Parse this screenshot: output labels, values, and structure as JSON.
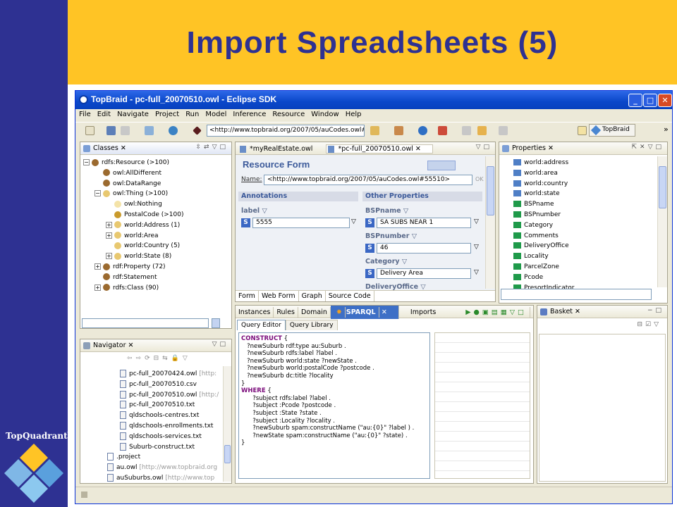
{
  "slide": {
    "title": "Import Spreadsheets (5)",
    "logo": "TopQuadrant",
    "logo_tm": "TM"
  },
  "window": {
    "title": "TopBraid - pc-full_20070510.owl - Eclipse SDK",
    "controls": [
      "_",
      "□",
      "✕"
    ]
  },
  "menu": [
    "File",
    "Edit",
    "Navigate",
    "Project",
    "Run",
    "Model",
    "Inference",
    "Resource",
    "Window",
    "Help"
  ],
  "toolbar": {
    "url": "<http://www.topbraid.org/2007/05/auCodes.owl#5",
    "perspective": "TopBraid",
    "more": "»"
  },
  "classes": {
    "tab": "Classes",
    "items": [
      {
        "label": "rdfs:Resource  (>100)",
        "toggle": "−",
        "color": "#9b6a2f"
      },
      {
        "label": "owl:AllDifferent",
        "toggle": "",
        "color": "#9b6a2f"
      },
      {
        "label": "owl:DataRange",
        "toggle": "",
        "color": "#9b6a2f"
      },
      {
        "label": "owl:Thing  (>100)",
        "toggle": "−",
        "color": "#e8c870"
      },
      {
        "label": "owl:Nothing",
        "toggle": "",
        "color": "#f4e3a8"
      },
      {
        "label": "PostalCode  (>100)",
        "toggle": "",
        "color": "#c99a2c"
      },
      {
        "label": "world:Address  (1)",
        "toggle": "+",
        "color": "#e8c870"
      },
      {
        "label": "world:Area",
        "toggle": "+",
        "color": "#e8c870"
      },
      {
        "label": "world:Country  (5)",
        "toggle": "",
        "color": "#e8c870"
      },
      {
        "label": "world:State  (8)",
        "toggle": "+",
        "color": "#e8c870"
      },
      {
        "label": "rdf:Property  (72)",
        "toggle": "+",
        "color": "#9b6a2f"
      },
      {
        "label": "rdf:Statement",
        "toggle": "",
        "color": "#9b6a2f"
      },
      {
        "label": "rdfs:Class  (90)",
        "toggle": "+",
        "color": "#9b6a2f"
      }
    ]
  },
  "editor": {
    "tabs": [
      "*myRealEstate.owl",
      "*pc-full_20070510.owl"
    ],
    "form_title": "Resource Form",
    "name_label": "Name:",
    "name_value": "<http://www.topbraid.org/2007/05/auCodes.owl#55510>",
    "ok": "OK",
    "annotations": "Annotations",
    "other_props": "Other Properties",
    "label_prop": "label ▽",
    "label_value": "5555",
    "props": [
      {
        "name": "BSPname ▽",
        "value": "SA SUBS NEAR 1"
      },
      {
        "name": "BSPnumber ▽",
        "value": "46"
      },
      {
        "name": "Category ▽",
        "value": "Delivery Area"
      },
      {
        "name": "DeliveryOffice ▽",
        "value": ""
      }
    ],
    "bottom_tabs": [
      "Form",
      "Web Form",
      "Graph",
      "Source Code"
    ]
  },
  "properties": {
    "tab": "Properties",
    "items": [
      {
        "label": "world:address",
        "color": "#4f7fc6"
      },
      {
        "label": "world:area",
        "color": "#4f7fc6"
      },
      {
        "label": "world:country",
        "color": "#4f7fc6"
      },
      {
        "label": "world:state",
        "color": "#4f7fc6"
      },
      {
        "label": "BSPname",
        "color": "#1f9a4a"
      },
      {
        "label": "BSPnumber",
        "color": "#1f9a4a"
      },
      {
        "label": "Category",
        "color": "#1f9a4a"
      },
      {
        "label": "Comments",
        "color": "#1f9a4a"
      },
      {
        "label": "DeliveryOffice",
        "color": "#1f9a4a"
      },
      {
        "label": "Locality",
        "color": "#1f9a4a"
      },
      {
        "label": "ParcelZone",
        "color": "#1f9a4a"
      },
      {
        "label": "Pcode",
        "color": "#1f9a4a"
      },
      {
        "label": "PresortIndicator",
        "color": "#1f9a4a"
      }
    ]
  },
  "navigator": {
    "tab": "Navigator",
    "items": [
      {
        "name": "pc-full_20070424.owl",
        "extra": "[http:"
      },
      {
        "name": "pc-full_20070510.csv",
        "extra": ""
      },
      {
        "name": "pc-full_20070510.owl",
        "extra": "[http:/"
      },
      {
        "name": "pc-full_20070510.txt",
        "extra": ""
      },
      {
        "name": "qldschools-centres.txt",
        "extra": ""
      },
      {
        "name": "qldschools-enrollments.txt",
        "extra": ""
      },
      {
        "name": "qldschools-services.txt",
        "extra": ""
      },
      {
        "name": "Suburb-construct.txt",
        "extra": ""
      },
      {
        "name": ".project",
        "extra": ""
      },
      {
        "name": "au.owl",
        "extra": "[http://www.topbraid.org"
      },
      {
        "name": "auSuburbs.owl",
        "extra": "[http://www.top"
      }
    ]
  },
  "sparql": {
    "tabs": [
      "Instances",
      "Rules",
      "Domain",
      "SPARQL",
      "Imports"
    ],
    "subtabs": [
      "Query Editor",
      "Query Library"
    ],
    "lines": [
      {
        "kw": "CONSTRUCT",
        "text": " {"
      },
      {
        "kw": "",
        "text": "   ?newSuburb rdf:type au:Suburb ."
      },
      {
        "kw": "",
        "text": "   ?newSuburb rdfs:label ?label ."
      },
      {
        "kw": "",
        "text": "   ?newSuburb world:state ?newState ."
      },
      {
        "kw": "",
        "text": "   ?newSuburb world:postalCode ?postcode ."
      },
      {
        "kw": "",
        "text": "   ?newSuburb dc:title ?locality"
      },
      {
        "kw": "",
        "text": "}"
      },
      {
        "kw": "WHERE",
        "text": " {"
      },
      {
        "kw": "",
        "text": "      ?subject rdfs:label ?label ."
      },
      {
        "kw": "",
        "text": "      ?subject :Pcode ?postcode ."
      },
      {
        "kw": "",
        "text": "      ?subject :State ?state ."
      },
      {
        "kw": "",
        "text": "      ?subject :Locality ?locality ."
      },
      {
        "kw": "",
        "text": "      ?newSuburb spam:constructName (\"au:{0}\" ?label ) ."
      },
      {
        "kw": "",
        "text": "      ?newState spam:constructName (\"au:{0}\" ?state) ."
      },
      {
        "kw": "",
        "text": "}"
      }
    ]
  },
  "basket": {
    "tab": "Basket"
  }
}
